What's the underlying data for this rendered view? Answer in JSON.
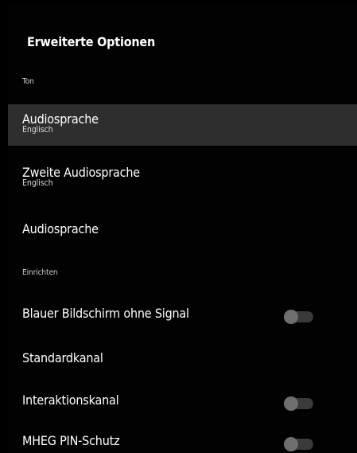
{
  "header": {
    "title": "Erweiterte Optionen"
  },
  "sections": {
    "sound": {
      "label": "Ton"
    },
    "setup": {
      "label": "Einrichten"
    }
  },
  "items": [
    {
      "label": "Audiosprache",
      "value": "Englisch",
      "selected": true
    },
    {
      "label": "Zweite Audiosprache",
      "value": "Englisch"
    },
    {
      "label": "Audiosprache"
    },
    {
      "label": "Blauer Bildschirm ohne Signal",
      "toggle": "off"
    },
    {
      "label": "Standardkanal"
    },
    {
      "label": "Interaktionskanal",
      "toggle": "off"
    },
    {
      "label": "MHEG PIN-Schutz",
      "toggle": "off"
    }
  ],
  "colors": {
    "background": "#000000",
    "selected_row": "#2e2e2e",
    "toggle_track": "#3a3a3a",
    "toggle_knob": "#6e6e6e"
  }
}
